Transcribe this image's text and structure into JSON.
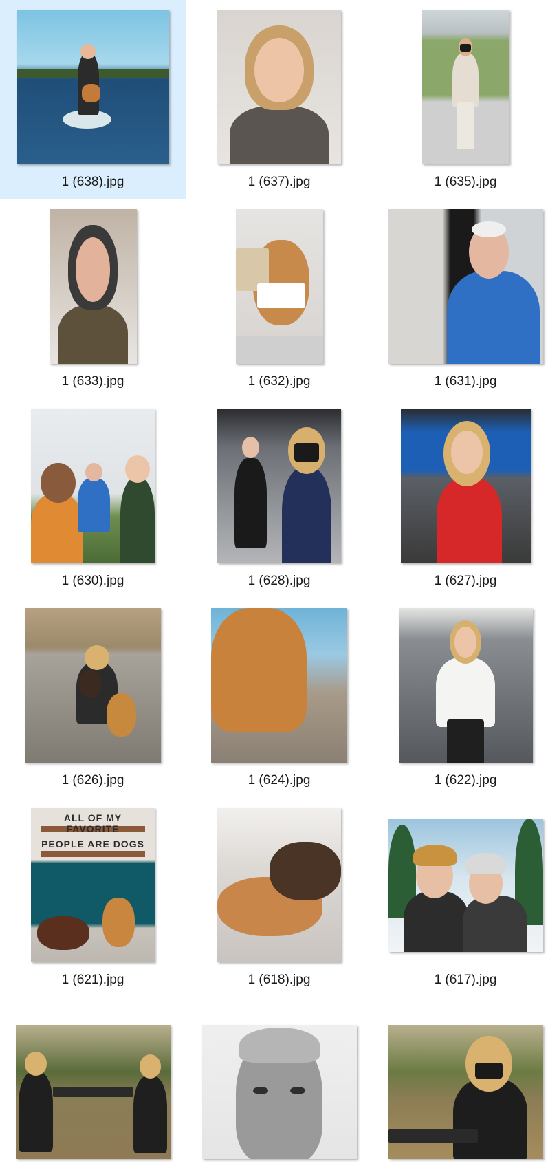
{
  "files": [
    {
      "name": "1 (638).jpg",
      "selected": true,
      "w": 222,
      "h": 225,
      "scene": "lake",
      "c1": "#4aa3c9",
      "c2": "#1f4e78",
      "c3": "#2b2b2b",
      "skin": "#e8b89a"
    },
    {
      "name": "1 (637).jpg",
      "selected": false,
      "w": 180,
      "h": 225,
      "scene": "portrait",
      "c1": "#d9d4cf",
      "c2": "#5a5550",
      "c3": "#c9a06a",
      "skin": "#eec4a6"
    },
    {
      "name": "1 (635).jpg",
      "selected": false,
      "w": 127,
      "h": 225,
      "scene": "street",
      "c1": "#8ba86a",
      "c2": "#cfcfcf",
      "c3": "#7a2a2a",
      "skin": "#d9b08e"
    },
    {
      "name": "1 (633).jpg",
      "selected": false,
      "w": 127,
      "h": 225,
      "scene": "portrait",
      "c1": "#bfb3a5",
      "c2": "#5d513c",
      "c3": "#3a3a3a",
      "skin": "#e2b39a"
    },
    {
      "name": "1 (632).jpg",
      "selected": false,
      "w": 127,
      "h": 225,
      "scene": "dog",
      "c1": "#e6e4e2",
      "c2": "#c88a4a",
      "c3": "#ffffff",
      "skin": "#c88a4a"
    },
    {
      "name": "1 (631).jpg",
      "selected": false,
      "w": 225,
      "h": 225,
      "scene": "door",
      "c1": "#d8d6d2",
      "c2": "#2f6fc4",
      "c3": "#1a1a1a",
      "skin": "#e3b7a0"
    },
    {
      "name": "1 (630).jpg",
      "selected": false,
      "w": 180,
      "h": 225,
      "scene": "group",
      "c1": "#e0e4e7",
      "c2": "#e08a34",
      "c3": "#2f4a2f",
      "skin": "#8a5a3c"
    },
    {
      "name": "1 (628).jpg",
      "selected": false,
      "w": 180,
      "h": 225,
      "scene": "studio",
      "c1": "#6c6f75",
      "c2": "#1a1a1a",
      "c3": "#22305a",
      "skin": "#e6c0a6"
    },
    {
      "name": "1 (627).jpg",
      "selected": false,
      "w": 189,
      "h": 225,
      "scene": "news",
      "c1": "#1d5fb4",
      "c2": "#d62828",
      "c3": "#3a3a3a",
      "skin": "#ecc5a8"
    },
    {
      "name": "1 (626).jpg",
      "selected": false,
      "w": 198,
      "h": 225,
      "scene": "rocks",
      "c1": "#b9a68a",
      "c2": "#2b2b2b",
      "c3": "#c6893e",
      "skin": "#e6bfa2"
    },
    {
      "name": "1 (624).jpg",
      "selected": false,
      "w": 198,
      "h": 225,
      "scene": "dogriver",
      "c1": "#6fb3d8",
      "c2": "#c9823c",
      "c3": "#a89a88",
      "skin": "#c9823c"
    },
    {
      "name": "1 (622).jpg",
      "selected": false,
      "w": 195,
      "h": 225,
      "scene": "office",
      "c1": "#8a8e93",
      "c2": "#f4f4f2",
      "c3": "#1f1f1f",
      "skin": "#ecc5a8"
    },
    {
      "name": "1 (621).jpg",
      "selected": false,
      "w": 180,
      "h": 225,
      "scene": "sign",
      "c1": "#e6e1da",
      "c2": "#0f5a66",
      "c3": "#5a2f1e",
      "skin": "#c8863f",
      "sign": [
        "ALL OF MY FAVORITE",
        "PEOPLE ARE DOGS"
      ]
    },
    {
      "name": "1 (618).jpg",
      "selected": false,
      "w": 180,
      "h": 225,
      "scene": "bed",
      "c1": "#dcd8d4",
      "c2": "#c8864a",
      "c3": "#4a3426",
      "skin": "#c8864a"
    },
    {
      "name": "1 (617).jpg",
      "selected": false,
      "w": 225,
      "h": 194,
      "scene": "snow",
      "c1": "#9cc4dd",
      "c2": "#2c2c2c",
      "c3": "#2c5e35",
      "skin": "#e7bfa4"
    },
    {
      "name": "",
      "selected": false,
      "w": 225,
      "h": 195,
      "scene": "park",
      "c1": "#8e7a55",
      "c2": "#1f1f1f",
      "c3": "#5a6b3a",
      "skin": "#e4bea2"
    },
    {
      "name": "",
      "selected": false,
      "w": 225,
      "h": 195,
      "scene": "bw",
      "c1": "#e5e5e5",
      "c2": "#9a9a9a",
      "c3": "#2e2e2e",
      "skin": "#c9c9c9"
    },
    {
      "name": "",
      "selected": false,
      "w": 225,
      "h": 195,
      "scene": "park2",
      "c1": "#a58c5c",
      "c2": "#1d1d1d",
      "c3": "#6b7b43",
      "skin": "#e4bea2"
    }
  ]
}
